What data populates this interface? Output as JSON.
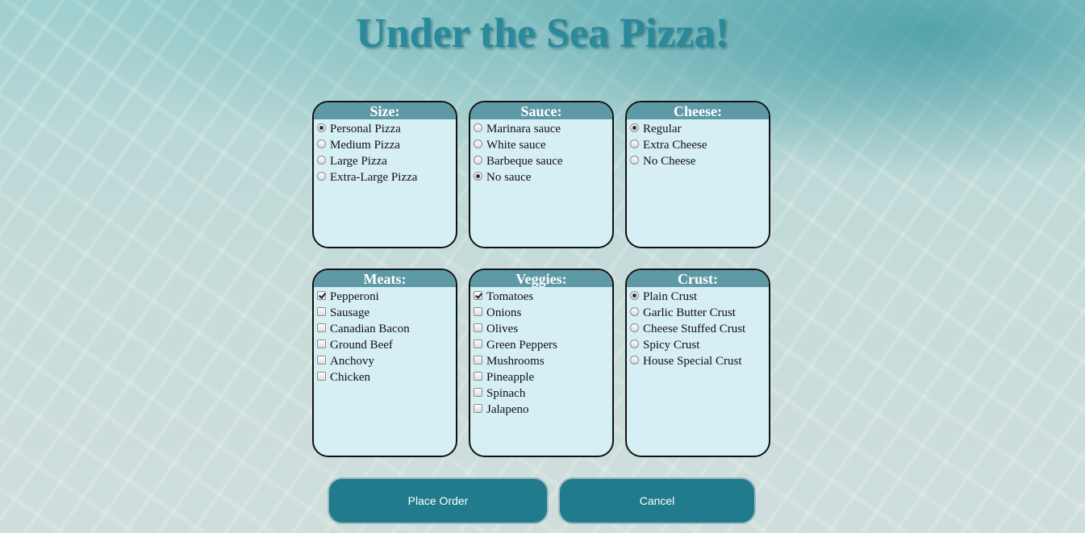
{
  "title": "Under the Sea Pizza!",
  "colors": {
    "title": "#2a8a9c",
    "panel_header": "#5e9aa6",
    "panel_body": "#d6eff5",
    "button": "#207c8c"
  },
  "panels": {
    "size": {
      "header": "Size:",
      "type": "radio",
      "options": [
        {
          "label": "Personal Pizza",
          "checked": true
        },
        {
          "label": "Medium Pizza",
          "checked": false
        },
        {
          "label": "Large Pizza",
          "checked": false
        },
        {
          "label": "Extra-Large Pizza",
          "checked": false
        }
      ]
    },
    "sauce": {
      "header": "Sauce:",
      "type": "radio",
      "options": [
        {
          "label": "Marinara sauce",
          "checked": false
        },
        {
          "label": "White sauce",
          "checked": false
        },
        {
          "label": "Barbeque sauce",
          "checked": false
        },
        {
          "label": "No sauce",
          "checked": true
        }
      ]
    },
    "cheese": {
      "header": "Cheese:",
      "type": "radio",
      "options": [
        {
          "label": "Regular",
          "checked": true
        },
        {
          "label": "Extra Cheese",
          "checked": false
        },
        {
          "label": "No Cheese",
          "checked": false
        }
      ]
    },
    "meats": {
      "header": "Meats:",
      "type": "checkbox",
      "options": [
        {
          "label": "Pepperoni",
          "checked": true
        },
        {
          "label": "Sausage",
          "checked": false
        },
        {
          "label": "Canadian Bacon",
          "checked": false
        },
        {
          "label": "Ground Beef",
          "checked": false
        },
        {
          "label": "Anchovy",
          "checked": false
        },
        {
          "label": "Chicken",
          "checked": false
        }
      ]
    },
    "veggies": {
      "header": "Veggies:",
      "type": "checkbox",
      "options": [
        {
          "label": "Tomatoes",
          "checked": true
        },
        {
          "label": "Onions",
          "checked": false
        },
        {
          "label": "Olives",
          "checked": false
        },
        {
          "label": "Green Peppers",
          "checked": false
        },
        {
          "label": "Mushrooms",
          "checked": false
        },
        {
          "label": "Pineapple",
          "checked": false
        },
        {
          "label": "Spinach",
          "checked": false
        },
        {
          "label": "Jalapeno",
          "checked": false
        }
      ]
    },
    "crust": {
      "header": "Crust:",
      "type": "radio",
      "options": [
        {
          "label": "Plain Crust",
          "checked": true
        },
        {
          "label": "Garlic Butter Crust",
          "checked": false
        },
        {
          "label": "Cheese Stuffed Crust",
          "checked": false
        },
        {
          "label": "Spicy Crust",
          "checked": false
        },
        {
          "label": "House Special Crust",
          "checked": false
        }
      ]
    }
  },
  "buttons": {
    "place_order": "Place Order",
    "cancel": "Cancel"
  }
}
